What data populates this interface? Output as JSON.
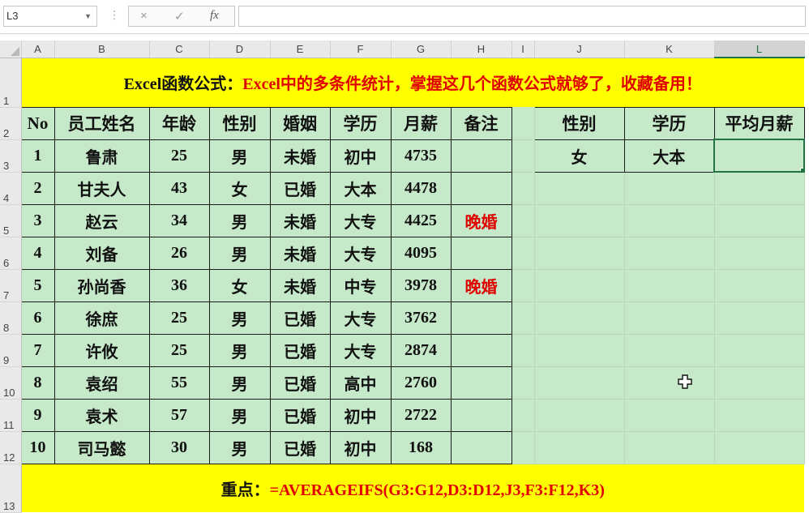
{
  "formula_bar": {
    "name_box": "L3",
    "cancel_icon": "×",
    "enter_icon": "✓",
    "fx_label": "fx",
    "formula": ""
  },
  "columns": [
    "A",
    "B",
    "C",
    "D",
    "E",
    "F",
    "G",
    "H",
    "I",
    "J",
    "K",
    "L"
  ],
  "rows": [
    "1",
    "2",
    "3",
    "4",
    "5",
    "6",
    "7",
    "8",
    "9",
    "10",
    "11",
    "12",
    "13"
  ],
  "title": {
    "black": "Excel函数公式：",
    "red": "Excel中的多条件统计，掌握这几个函数公式就够了，收藏备用！"
  },
  "table": {
    "headers": [
      "No",
      "员工姓名",
      "年龄",
      "性别",
      "婚姻",
      "学历",
      "月薪",
      "备注"
    ],
    "rows": [
      [
        "1",
        "鲁肃",
        "25",
        "男",
        "未婚",
        "初中",
        "4735",
        ""
      ],
      [
        "2",
        "甘夫人",
        "43",
        "女",
        "已婚",
        "大本",
        "4478",
        ""
      ],
      [
        "3",
        "赵云",
        "34",
        "男",
        "未婚",
        "大专",
        "4425",
        "晚婚"
      ],
      [
        "4",
        "刘备",
        "26",
        "男",
        "未婚",
        "大专",
        "4095",
        ""
      ],
      [
        "5",
        "孙尚香",
        "36",
        "女",
        "未婚",
        "中专",
        "3978",
        "晚婚"
      ],
      [
        "6",
        "徐庶",
        "25",
        "男",
        "已婚",
        "大专",
        "3762",
        ""
      ],
      [
        "7",
        "许攸",
        "25",
        "男",
        "已婚",
        "大专",
        "2874",
        ""
      ],
      [
        "8",
        "袁绍",
        "55",
        "男",
        "已婚",
        "高中",
        "2760",
        ""
      ],
      [
        "9",
        "袁术",
        "57",
        "男",
        "已婚",
        "初中",
        "2722",
        ""
      ],
      [
        "10",
        "司马懿",
        "30",
        "男",
        "已婚",
        "初中",
        "168",
        ""
      ]
    ]
  },
  "criteria": {
    "headers": [
      "性别",
      "学历",
      "平均月薪"
    ],
    "values": [
      "女",
      "大本",
      ""
    ]
  },
  "footer": {
    "black": "重点：",
    "red": "=AVERAGEIFS(G3:G12,D3:D12,J3,F3:F12,K3)"
  },
  "colors": {
    "header_yellow": "#ffff00",
    "table_green": "#c6e9c9",
    "accent_red": "#e00000",
    "excel_green": "#217346"
  }
}
